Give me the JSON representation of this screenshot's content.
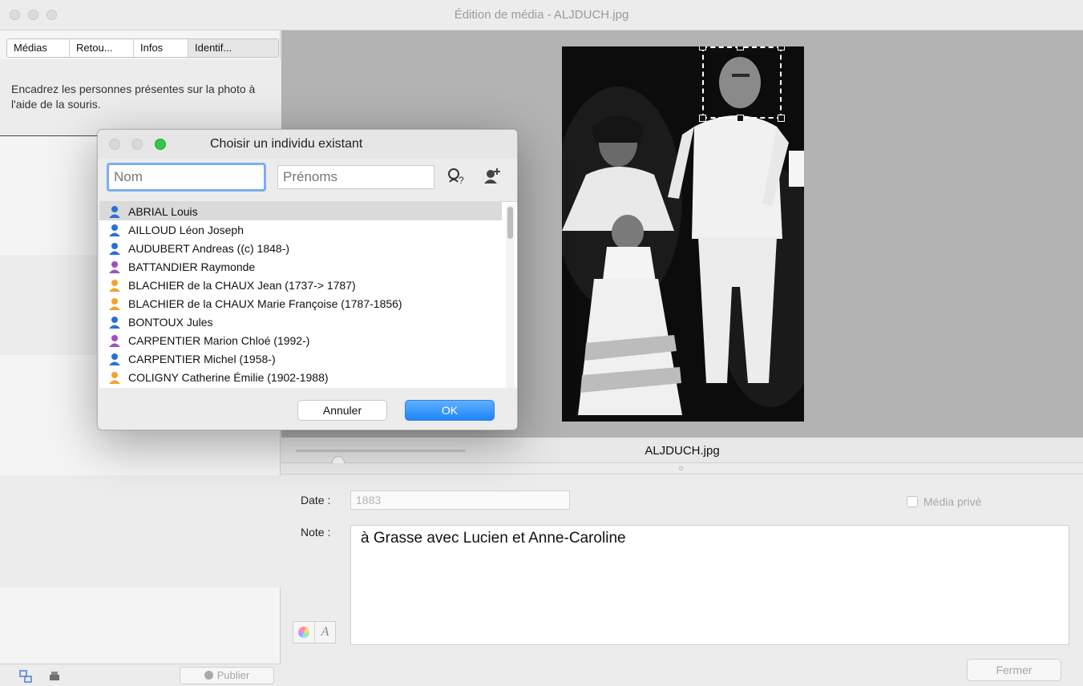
{
  "window": {
    "title": "Édition de média - ALJDUCH.jpg"
  },
  "left_panel": {
    "tabs": [
      "Médias",
      "Retou...",
      "Infos",
      "Identif..."
    ],
    "instruction": "Encadrez les personnes présentes sur la photo à l'aide de la souris.",
    "publish_label": "Publier"
  },
  "preview": {
    "filename": "ALJDUCH.jpg",
    "zoom_slider_value": 0.25
  },
  "form": {
    "date_label": "Date :",
    "date_value": "1883",
    "private_label": "Média privé",
    "private_checked": false,
    "note_label": "Note :",
    "note_value": "à Grasse avec Lucien et Anne-Caroline",
    "close_label": "Fermer"
  },
  "dialog": {
    "title": "Choisir un individu existant",
    "nom_placeholder": "Nom",
    "prenoms_placeholder": "Prénoms",
    "cancel_label": "Annuler",
    "ok_label": "OK",
    "people": [
      {
        "name": "ABRIAL Louis",
        "color": "#2a6fd6",
        "selected": true
      },
      {
        "name": "AILLOUD Léon Joseph",
        "color": "#2a6fd6"
      },
      {
        "name": "AUDUBERT Andreas ((c) 1848-)",
        "color": "#2a6fd6"
      },
      {
        "name": "BATTANDIER Raymonde",
        "color": "#a24fbf"
      },
      {
        "name": "BLACHIER de la CHAUX Jean (1737-> 1787)",
        "color": "#f1a42a"
      },
      {
        "name": "BLACHIER de la CHAUX Marie Françoise (1787-1856)",
        "color": "#f1a42a"
      },
      {
        "name": "BONTOUX Jules",
        "color": "#2a6fd6"
      },
      {
        "name": "CARPENTIER Marion Chloé (1992-)",
        "color": "#a24fbf"
      },
      {
        "name": "CARPENTIER Michel (1958-)",
        "color": "#2a6fd6"
      },
      {
        "name": "COLIGNY Catherine Émilie (1902-1988)",
        "color": "#f1a42a"
      }
    ]
  },
  "colors": {
    "accent": "#1e84f7",
    "selection_handles": "#111111"
  }
}
